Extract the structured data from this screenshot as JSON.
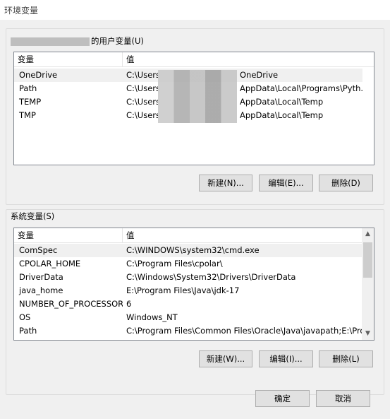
{
  "window": {
    "title": "环境变量"
  },
  "user_vars": {
    "group_label_suffix": "的用户变量(U)",
    "headers": {
      "name": "变量",
      "value": "值"
    },
    "rows": [
      {
        "name": "OneDrive",
        "value_prefix": "C:\\Users",
        "value_suffix": "OneDrive"
      },
      {
        "name": "Path",
        "value_prefix": "C:\\Users",
        "value_suffix": "AppData\\Local\\Programs\\Pyth..."
      },
      {
        "name": "TEMP",
        "value_prefix": "C:\\Users",
        "value_suffix": "AppData\\Local\\Temp"
      },
      {
        "name": "TMP",
        "value_prefix": "C:\\Users",
        "value_suffix": "AppData\\Local\\Temp"
      }
    ],
    "buttons": {
      "new": "新建(N)...",
      "edit": "编辑(E)...",
      "delete": "删除(D)"
    }
  },
  "system_vars": {
    "group_label": "系统变量(S)",
    "headers": {
      "name": "变量",
      "value": "值"
    },
    "rows": [
      {
        "name": "ComSpec",
        "value": "C:\\WINDOWS\\system32\\cmd.exe"
      },
      {
        "name": "CPOLAR_HOME",
        "value": "C:\\Program Files\\cpolar\\"
      },
      {
        "name": "DriverData",
        "value": "C:\\Windows\\System32\\Drivers\\DriverData"
      },
      {
        "name": "java_home",
        "value": "E:\\Program Files\\Java\\jdk-17"
      },
      {
        "name": "NUMBER_OF_PROCESSORS",
        "value": "6"
      },
      {
        "name": "OS",
        "value": "Windows_NT"
      },
      {
        "name": "Path",
        "value": "C:\\Program Files\\Common Files\\Oracle\\Java\\javapath;E:\\Prog..."
      }
    ],
    "buttons": {
      "new": "新建(W)...",
      "edit": "编辑(I)...",
      "delete": "删除(L)"
    }
  },
  "dialog_buttons": {
    "ok": "确定",
    "cancel": "取消"
  }
}
